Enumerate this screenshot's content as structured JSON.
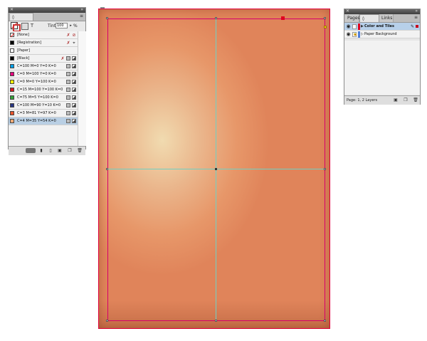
{
  "swatches_panel": {
    "tab_label": "◊ Swatches",
    "tint_label": "Tint:",
    "tint_value": "100",
    "tint_unit": "%",
    "items": [
      {
        "name": "[None]",
        "color": "none",
        "selected": false
      },
      {
        "name": "[Registration]",
        "color": "#000000",
        "selected": false
      },
      {
        "name": "[Paper]",
        "color": "#ffffff",
        "selected": false
      },
      {
        "name": "[Black]",
        "color": "#000000",
        "selected": false
      },
      {
        "name": "C=100 M=0 Y=0 K=0",
        "color": "#00a0e8",
        "selected": false
      },
      {
        "name": "C=0 M=100 Y=0 K=0",
        "color": "#e6007e",
        "selected": false
      },
      {
        "name": "C=0 M=0 Y=100 K=0",
        "color": "#fff100",
        "selected": false
      },
      {
        "name": "C=15 M=100 Y=100 K=0",
        "color": "#d71920",
        "selected": false
      },
      {
        "name": "C=75 M=5 Y=100 K=0",
        "color": "#33a139",
        "selected": false
      },
      {
        "name": "C=100 M=90 Y=10 K=0",
        "color": "#283583",
        "selected": false
      },
      {
        "name": "C=3 M=81 Y=97 K=0",
        "color": "#e8532b",
        "selected": false
      },
      {
        "name": "C=4 M=35 Y=54 K=0",
        "color": "#efaa76",
        "selected": true
      }
    ]
  },
  "layers_panel": {
    "tabs": [
      "Pages",
      "◊ Layers",
      "Links"
    ],
    "layers": [
      {
        "name": "Color and Tiles",
        "color": "#e0001f",
        "selected": true
      },
      {
        "name": "Paper Background",
        "color": "#4f7fd8",
        "selected": false
      }
    ],
    "status": "Page: 1, 2 Layers"
  }
}
